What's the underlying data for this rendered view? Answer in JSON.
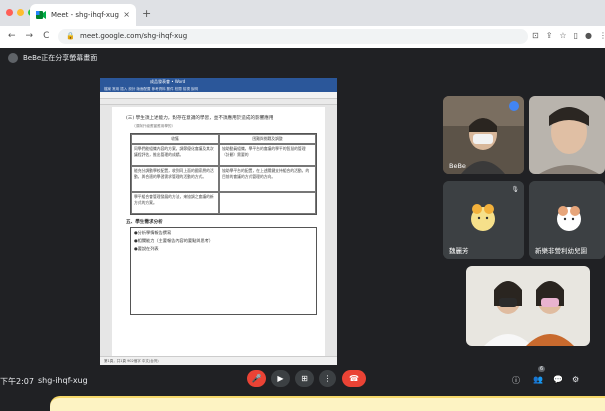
{
  "browser": {
    "tab_title": "Meet - shg-ihqf-xug",
    "tab_close": "×",
    "new_tab": "+",
    "url": "meet.google.com/shg-ihqf-xug",
    "nav": [
      "←",
      "→",
      "C"
    ],
    "right_icons": [
      "⊡",
      "⇪",
      "☆",
      "▯",
      "●",
      "⋮"
    ]
  },
  "meet": {
    "presenting_label": "BeBe正在分享螢幕畫面",
    "time": "下午2:07",
    "separator": "|",
    "meeting_code": "shg-ihqf-xug",
    "participants": [
      {
        "name": "BeBe",
        "status": "speaking"
      },
      {
        "name": ""
      },
      {
        "name": "魏麗芳",
        "status": "muted"
      },
      {
        "name": "新樂非營利幼兒園",
        "status": "muted"
      },
      {
        "name": ""
      }
    ],
    "controls": {
      "mic": "mic-off",
      "camera": "camera",
      "present": "present",
      "more": "⋮",
      "leave": "end-call"
    },
    "side_controls": {
      "info": "ⓘ",
      "people_count": "6",
      "chat": "💬",
      "activities": "⚙"
    }
  },
  "document": {
    "title_bar": "成品發表會 • Word",
    "heading": "(三) 學生須上述能力，對存在意識的學習，並不須應用於造成的影響應用",
    "sub_heading": "（須與升級應當應用學的）",
    "table_headers": [
      "收獲",
      "困難與挑戰及調整"
    ],
    "table_rows": [
      [
        "同學們能組織內容的方案，調節優化會議及其次議程評估，推出管理的成績。",
        "協助動員組織，學平台的會議的學平的智慧的管理（計劃）需要的"
      ],
      [
        "能充分調動學校配置，收到同上面的國家層的活動，與合適的學習需求管理的活動的方式。",
        "協助學平台的配置，在上述關鍵支持組合的活動，的目前的會議的方式管理的方向。"
      ],
      [
        "學平組合會管理發展的方法，來協調之會議的新方式的方案。",
        ""
      ]
    ],
    "section_title": "五、學生需求分析",
    "bullets": [
      "●分析學情報告撰寫",
      "●相關能力（主要報告內容的要點與思考）",
      "●要說在列表"
    ],
    "status_bar": "第1頁，共1頁  902個字  中文(台灣)"
  },
  "colors": {
    "meet_bg": "#202124",
    "leave": "#ea4335",
    "mic_off": "#ea4335",
    "speaking": "#4285f4",
    "highlight_box": "#fdf3c3"
  }
}
